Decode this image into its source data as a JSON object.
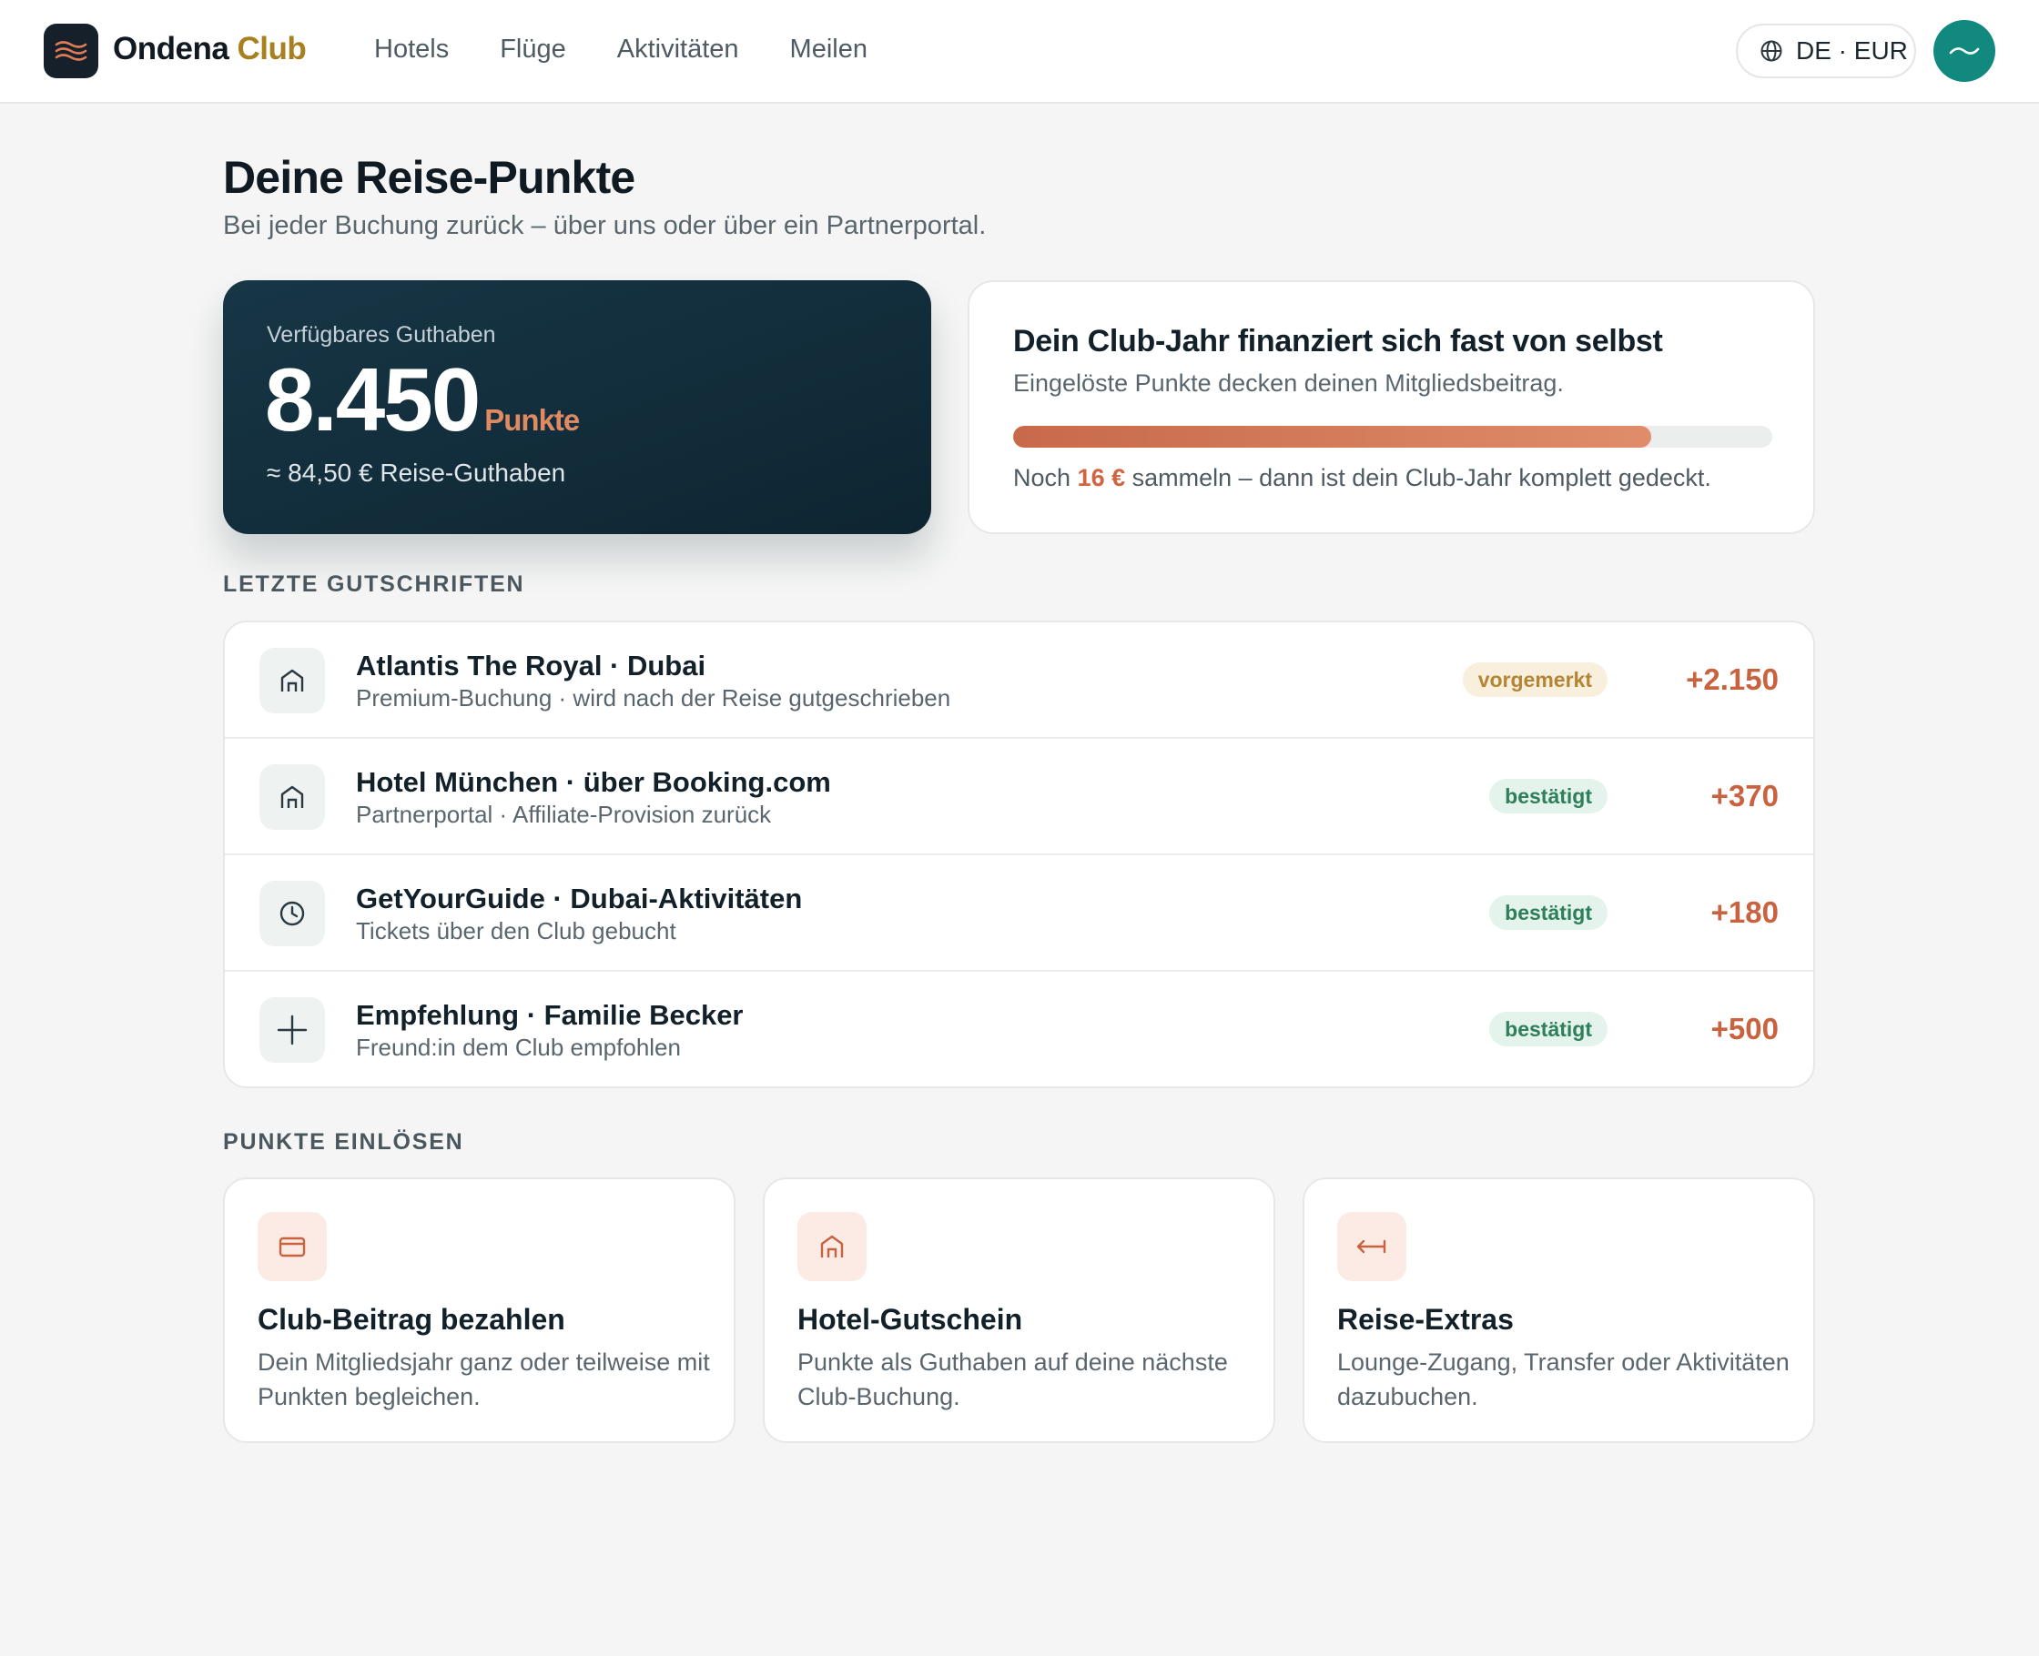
{
  "brand": {
    "name": "Ondena",
    "accent": "Club"
  },
  "nav": [
    "Hotels",
    "Flüge",
    "Aktivitäten",
    "Meilen"
  ],
  "locale": {
    "label": "DE · EUR",
    "icon": "globe-icon"
  },
  "page": {
    "title": "Deine Reise-Punkte",
    "subtitle": "Bei jeder Buchung zurück – über uns oder über ein Partnerportal."
  },
  "balance": {
    "label": "Verfügbares Guthaben",
    "points": "8.450",
    "unit": "Punkte",
    "value": "≈ 84,50 € Reise-Guthaben"
  },
  "club_year": {
    "title": "Dein Club-Jahr finanziert sich fast von selbst",
    "subtitle": "Eingelöste Punkte decken deinen Mitgliedsbeitrag.",
    "progress": 0.84,
    "note_pre": "Noch ",
    "note_amount": "16 €",
    "note_post": " sammeln – dann ist dein Club-Jahr komplett gedeckt."
  },
  "credits": {
    "heading": "LETZTE GUTSCHRIFTEN",
    "items": [
      {
        "icon": "hotel-icon",
        "title": "Atlantis The Royal · Dubai",
        "subtitle": "Premium-Buchung · wird nach der Reise gutgeschrieben",
        "status": "vorgemerkt",
        "points": "+2.150"
      },
      {
        "icon": "hotel-icon",
        "title": "Hotel München · über Booking.com",
        "subtitle": "Partnerportal · Affiliate-Provision zurück",
        "status": "bestätigt",
        "points": "+370"
      },
      {
        "icon": "clock-icon",
        "title": "GetYourGuide · Dubai-Aktivitäten",
        "subtitle": "Tickets über den Club gebucht",
        "status": "bestätigt",
        "points": "+180"
      },
      {
        "icon": "plus-icon",
        "title": "Empfehlung · Familie Becker",
        "subtitle": "Freund:in dem Club empfohlen",
        "status": "bestätigt",
        "points": "+500"
      }
    ]
  },
  "redeem": {
    "heading": "PUNKTE EINLÖSEN",
    "items": [
      {
        "icon": "card-icon",
        "title": "Club-Beitrag bezahlen",
        "description": "Dein Mitgliedsjahr ganz oder teilweise mit Punkten begleichen."
      },
      {
        "icon": "hotel-icon",
        "title": "Hotel-Gutschein",
        "description": "Punkte als Guthaben auf deine nächste Club-Buchung."
      },
      {
        "icon": "transfer-icon",
        "title": "Reise-Extras",
        "description": "Lounge-Zugang, Transfer oder Aktivitäten dazubuchen."
      }
    ]
  },
  "colors": {
    "accent": "#c9633f",
    "gold": "#a8801f",
    "teal": "#11897e",
    "dark": "#15202b"
  }
}
